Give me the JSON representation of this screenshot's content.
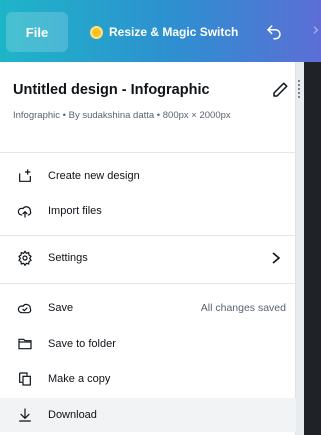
{
  "toolbar": {
    "file_label": "File",
    "resize_label": "Resize & Magic Switch",
    "undo_icon": "undo-icon",
    "brand_gradient": [
      "#1eb5c8",
      "#2e8fd0",
      "#5c6ed6"
    ]
  },
  "menu": {
    "title": "Untitled design - Infographic",
    "subtitle": "Infographic • By sudakshina datta • 800px × 2000px",
    "items": [
      {
        "label": "Create new design",
        "icon": "plus-document-icon"
      },
      {
        "label": "Import files",
        "icon": "cloud-upload-icon"
      },
      {
        "label": "Settings",
        "icon": "gear-icon",
        "has_submenu": true
      },
      {
        "label": "Save",
        "icon": "cloud-check-icon",
        "status": "All changes saved"
      },
      {
        "label": "Save to folder",
        "icon": "folder-icon"
      },
      {
        "label": "Make a copy",
        "icon": "copy-icon"
      },
      {
        "label": "Download",
        "icon": "download-icon"
      }
    ]
  }
}
